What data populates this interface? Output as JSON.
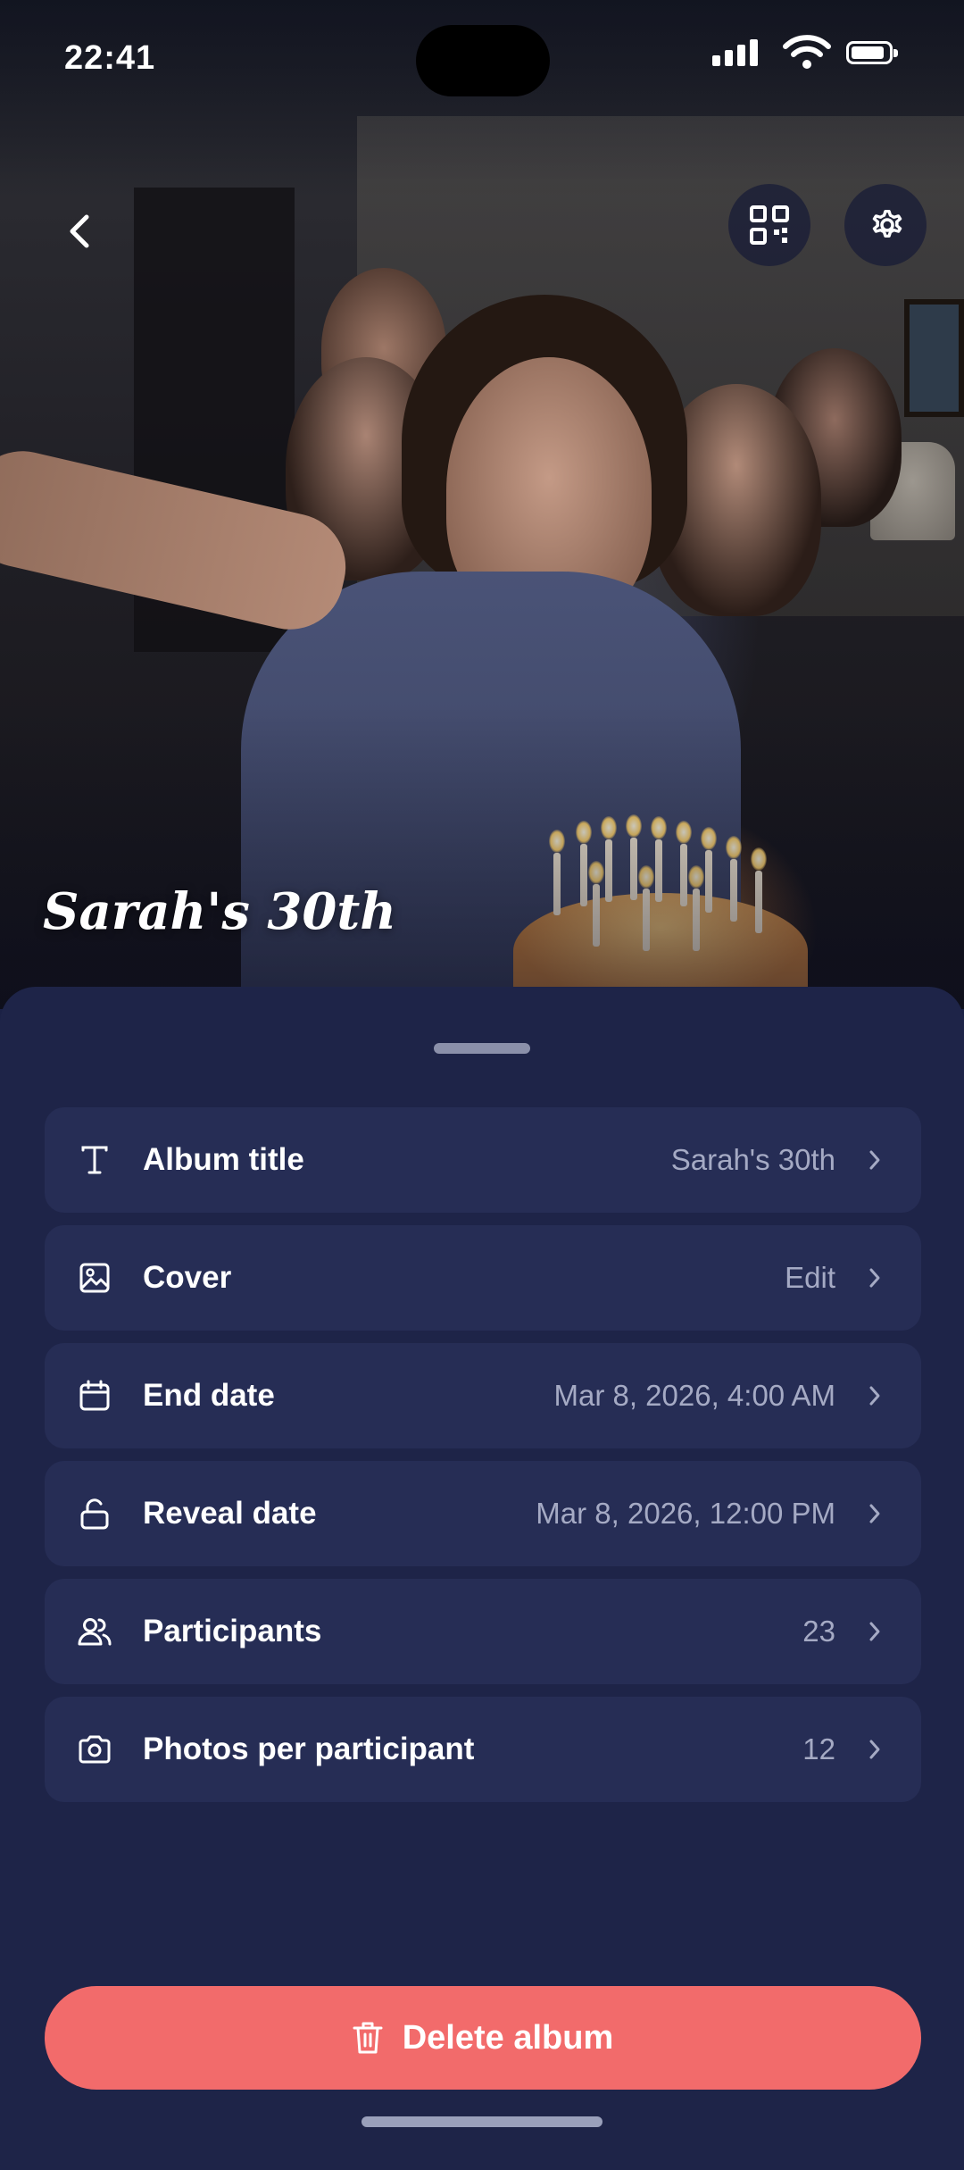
{
  "status_bar": {
    "time": "22:41"
  },
  "header": {
    "album_heading": "Sarah's 30th",
    "icons": {
      "back": "chevron-left-icon",
      "qr": "qr-code-icon",
      "settings": "gear-icon"
    }
  },
  "settings": {
    "rows": [
      {
        "icon": "text-icon",
        "label": "Album title",
        "value": "Sarah's 30th"
      },
      {
        "icon": "image-icon",
        "label": "Cover",
        "value": "Edit"
      },
      {
        "icon": "calendar-icon",
        "label": "End date",
        "value": "Mar 8, 2026, 4:00 AM"
      },
      {
        "icon": "unlock-icon",
        "label": "Reveal date",
        "value": "Mar 8, 2026, 12:00 PM"
      },
      {
        "icon": "users-icon",
        "label": "Participants",
        "value": "23"
      },
      {
        "icon": "camera-icon",
        "label": "Photos per participant",
        "value": "12"
      }
    ]
  },
  "actions": {
    "delete_label": "Delete album",
    "delete_color": "#f26b6b"
  },
  "colors": {
    "sheet_background": "#1e2448",
    "row_background": "#262d55",
    "value_text": "#a5aac4"
  }
}
